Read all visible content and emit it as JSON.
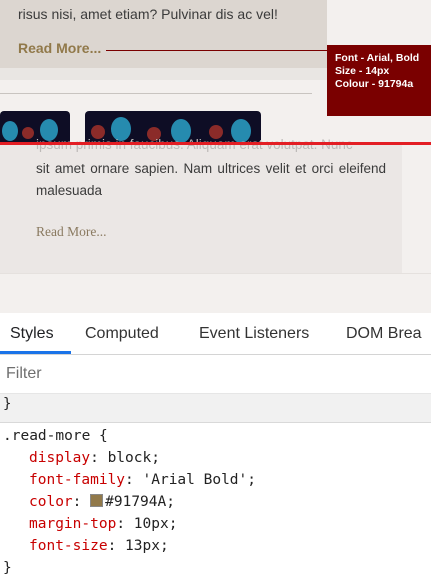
{
  "preview": {
    "top_card_text": "risus nisi, amet etiam? Pulvinar dis ac vel!",
    "read_more_top": "Read More...",
    "annotation": {
      "line1": "Font - Arial, Bold",
      "line2": "Size - 14px",
      "line3": "Colour - 91794a"
    },
    "bottom_card_overlap_text": "ipsum primis in faucibus. Aliquam erat volutpat. Nunc",
    "bottom_card_text": "sit amet ornare sapien. Nam ultrices velit et orci eleifend malesuada",
    "read_more_bottom": "Read More..."
  },
  "devtools": {
    "tabs": [
      "Styles",
      "Computed",
      "Event Listeners",
      "DOM Brea"
    ],
    "active_tab": "Styles",
    "filter_placeholder": "Filter",
    "prev_rule_brace": "}",
    "rule": {
      "selector": ".read-more {",
      "declarations": [
        {
          "prop": "display",
          "value": "block;"
        },
        {
          "prop": "font-family",
          "value": "'Arial Bold';"
        },
        {
          "prop": "color",
          "value": "#91794A;"
        },
        {
          "prop": "margin-top",
          "value": "10px;"
        },
        {
          "prop": "font-size",
          "value": "13px;"
        }
      ],
      "close": "}"
    }
  },
  "colors": {
    "read_more": "#91794a",
    "annotation_bg": "#7a0000",
    "highlight_line": "#e31e24",
    "tab_active": "#1a73e8",
    "css_property": "#c80000"
  }
}
